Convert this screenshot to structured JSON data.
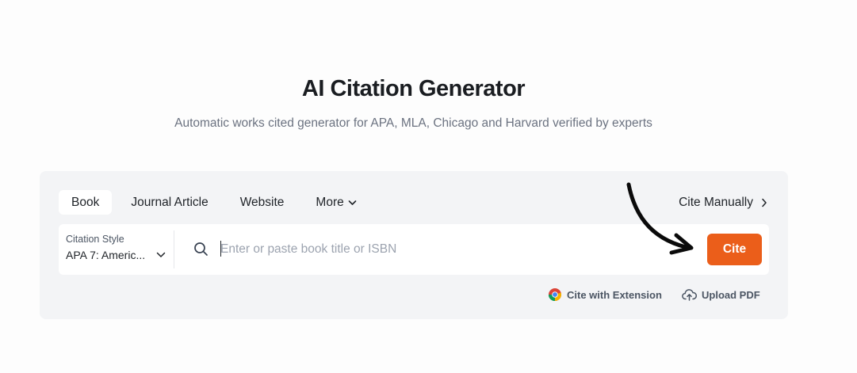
{
  "header": {
    "title": "AI Citation Generator",
    "subtitle": "Automatic works cited generator for APA, MLA, Chicago and Harvard verified by experts"
  },
  "tabs": [
    {
      "label": "Book",
      "active": true
    },
    {
      "label": "Journal Article",
      "active": false
    },
    {
      "label": "Website",
      "active": false
    },
    {
      "label": "More",
      "active": false,
      "icon": "chevron-down-icon"
    }
  ],
  "cite_manually": {
    "label": "Cite Manually",
    "icon": "chevron-right-icon"
  },
  "citation_style": {
    "label": "Citation Style",
    "value": "APA 7: Americ...",
    "icon": "chevron-down-icon"
  },
  "search": {
    "placeholder": "Enter or paste book title or ISBN",
    "value": "",
    "icon": "search-icon"
  },
  "cite_button": {
    "label": "Cite",
    "color": "#eb5e1a"
  },
  "extension_link": {
    "label": "Cite with Extension",
    "icon": "chrome-icon"
  },
  "upload_link": {
    "label": "Upload PDF",
    "icon": "cloud-upload-icon"
  },
  "annotation": {
    "icon": "curved-arrow-icon",
    "points_to": "cite_button"
  }
}
